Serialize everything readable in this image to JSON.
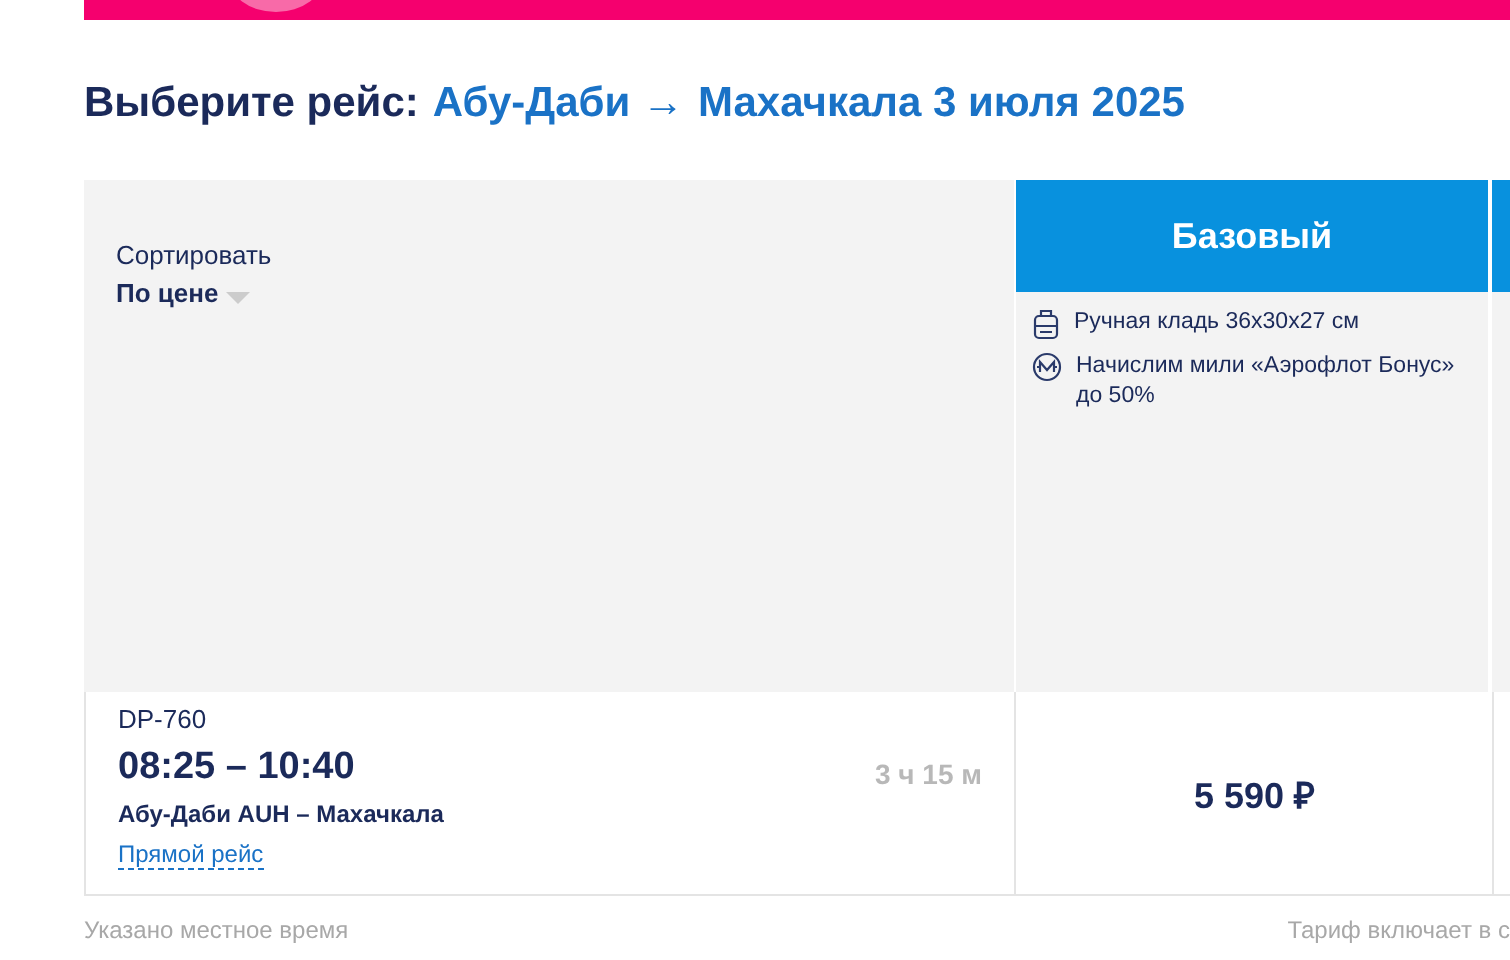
{
  "heading": {
    "label": "Выберите рейс:",
    "route": "Абу-Даби →",
    "destination": "Махачкала 3 июля 2025"
  },
  "sort": {
    "label": "Сортировать",
    "value": "По цене"
  },
  "fares": [
    {
      "name": "Базовый",
      "price": "5 590 ₽",
      "features": [
        {
          "kind": "baggage",
          "text": "Ручная кладь 36x30x27 см"
        },
        {
          "kind": "miles",
          "text": "Начислим мили «Аэрофлот Бонус» до 50%"
        }
      ]
    }
  ],
  "flight": {
    "number": "DP-760",
    "times": "08:25 – 10:40",
    "route": "Абу-Даби AUH – Махачкала",
    "duration": "3 ч 15 м",
    "type_link": "Прямой рейс"
  },
  "footer": {
    "note": "Указано местное время",
    "tariff_note": "Тариф включает в с"
  }
}
